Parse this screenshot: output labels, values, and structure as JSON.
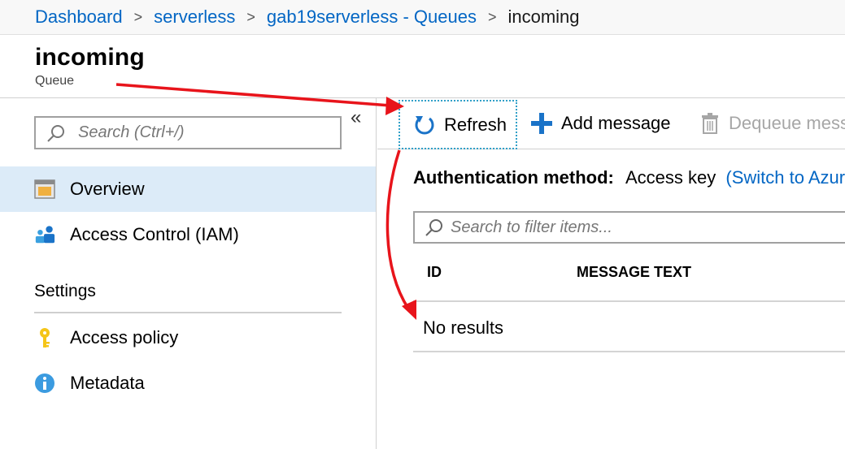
{
  "breadcrumb": {
    "items": [
      "Dashboard",
      "serverless",
      "gab19serverless - Queues"
    ],
    "current": "incoming"
  },
  "header": {
    "title": "incoming",
    "subtitle": "Queue"
  },
  "sidebar": {
    "search_placeholder": "Search (Ctrl+/)",
    "collapse_glyph": "«",
    "items": [
      {
        "label": "Overview",
        "icon": "overview-icon",
        "active": true
      },
      {
        "label": "Access Control (IAM)",
        "icon": "people-icon",
        "active": false
      }
    ],
    "section": "Settings",
    "settings_items": [
      {
        "label": "Access policy",
        "icon": "key-icon"
      },
      {
        "label": "Metadata",
        "icon": "info-icon"
      }
    ]
  },
  "toolbar": {
    "refresh_label": "Refresh",
    "add_label": "Add message",
    "dequeue_label": "Dequeue mess"
  },
  "auth": {
    "label": "Authentication method:",
    "value": "Access key",
    "link": "(Switch to Azur"
  },
  "filter": {
    "placeholder": "Search to filter items..."
  },
  "table": {
    "columns": [
      "ID",
      "MESSAGE TEXT"
    ],
    "empty_text": "No results"
  },
  "colors": {
    "link": "#0366c4",
    "active_nav": "#dcebf8",
    "annotation_arrow": "#e8141b"
  }
}
